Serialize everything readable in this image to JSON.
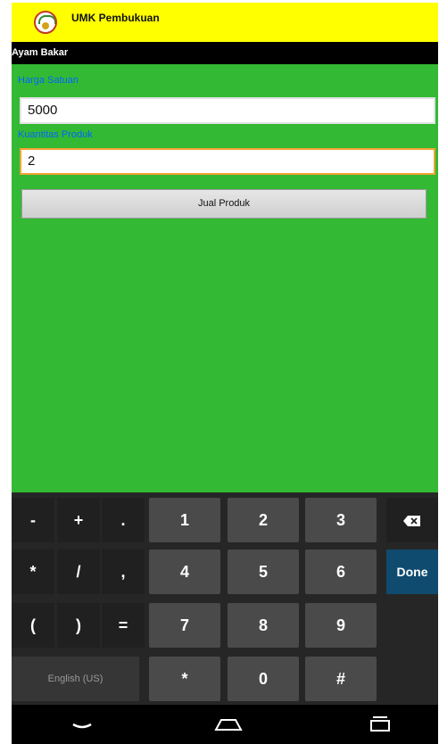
{
  "app": {
    "title": "UMK Pembukuan"
  },
  "product": {
    "name": "Ayam Bakar"
  },
  "form": {
    "price_label": "Harga Satuan",
    "price_value": "5000",
    "quantity_label": "Kuantitas Produk",
    "quantity_value": "2",
    "sell_button": "Jual Produk"
  },
  "keyboard": {
    "row1": [
      "-",
      "+",
      ".",
      "1",
      "2",
      "3"
    ],
    "row2": [
      "*",
      "/",
      ",",
      "4",
      "5",
      "6"
    ],
    "row3": [
      "(",
      ")",
      "=",
      "7",
      "8",
      "9"
    ],
    "row4": [
      "English (US)",
      "*",
      "0",
      "#"
    ],
    "done_label": "Done"
  },
  "colors": {
    "app_bar": "#ffff00",
    "content_bg": "#33b933",
    "label": "#0066ff",
    "done_key": "#0f4b6e"
  },
  "icons": [
    "app-logo-icon",
    "backspace-icon",
    "back-icon",
    "home-icon",
    "recent-apps-icon"
  ]
}
